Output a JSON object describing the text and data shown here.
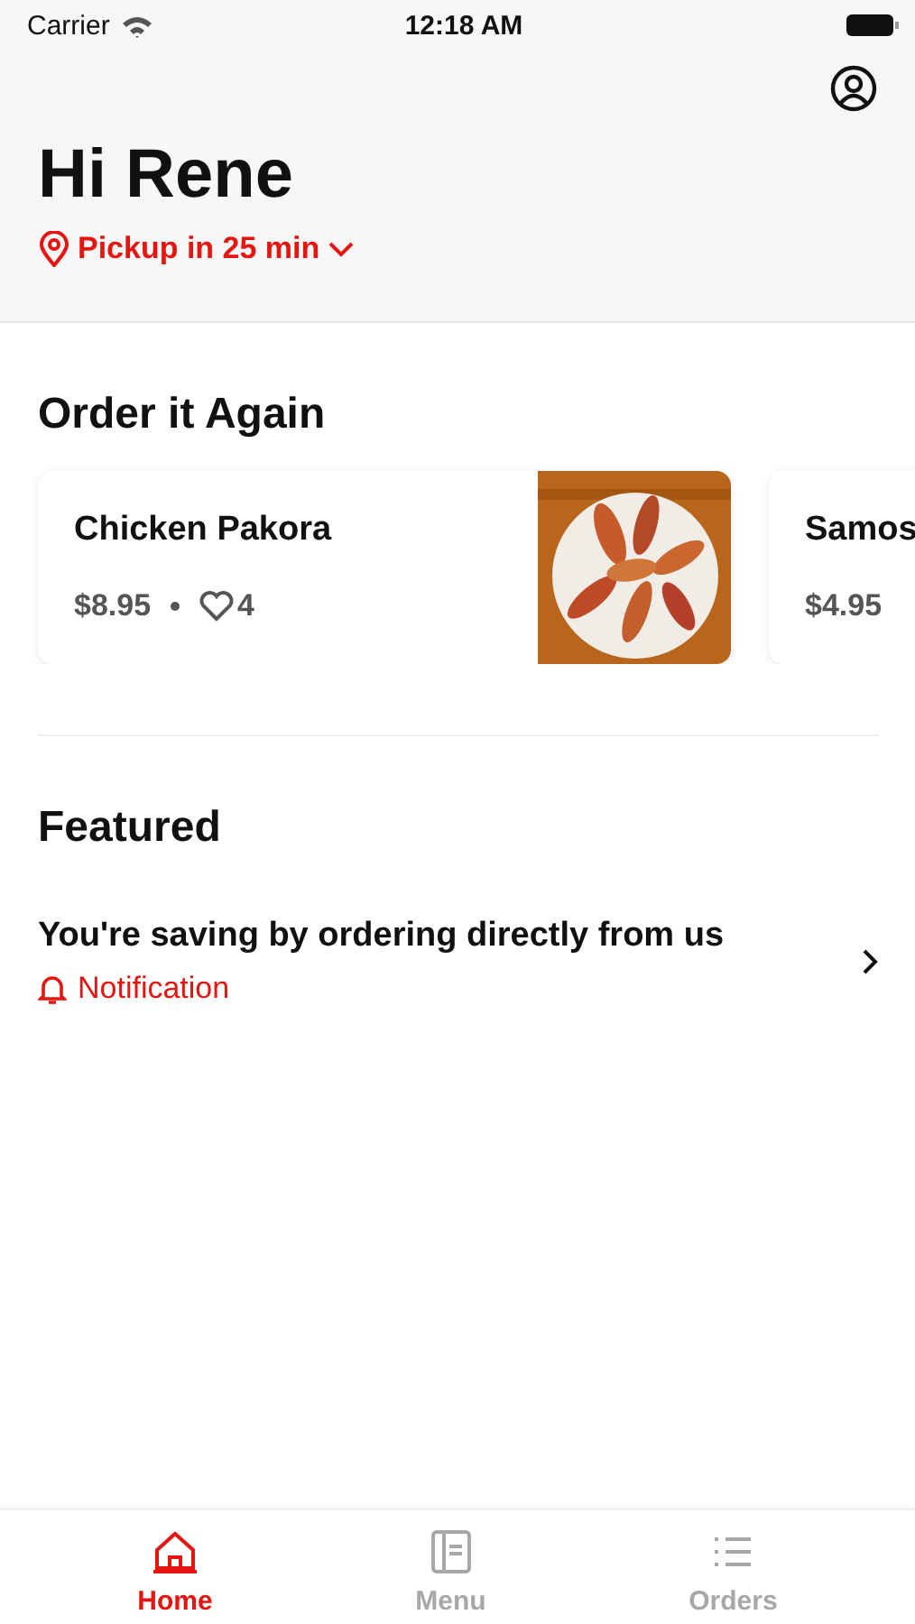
{
  "status_bar": {
    "carrier": "Carrier",
    "time": "12:18 AM"
  },
  "header": {
    "greeting": "Hi Rene",
    "pickup": "Pickup in 25 min"
  },
  "order_again": {
    "title": "Order it Again",
    "items": [
      {
        "name": "Chicken Pakora",
        "price": "$8.95",
        "likes": "4"
      },
      {
        "name": "Samos",
        "price": "$4.95"
      }
    ]
  },
  "featured": {
    "title": "Featured",
    "items": [
      {
        "title": "You're saving by ordering directly from us",
        "subtitle": "Notification"
      }
    ]
  },
  "tabs": [
    {
      "label": "Home",
      "kind": "home",
      "selected": true
    },
    {
      "label": "Menu",
      "kind": "menu",
      "selected": false
    },
    {
      "label": "Orders",
      "kind": "orders",
      "selected": false
    }
  ]
}
